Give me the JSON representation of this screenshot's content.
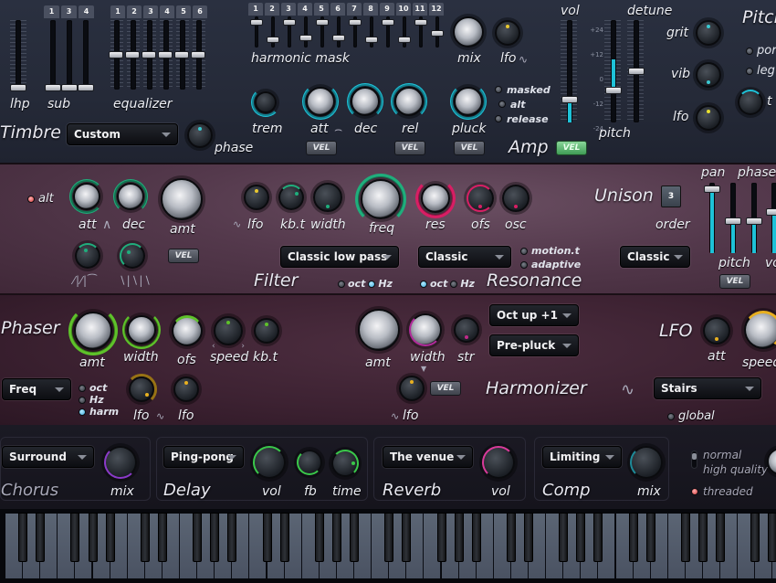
{
  "timbre": {
    "title": "Timbre",
    "preset": "Custom",
    "phase_label": "phase",
    "lhp_label": "lhp",
    "sub_label": "sub",
    "sub_tabs": [
      "1",
      "3",
      "4"
    ],
    "eq_label": "equalizer",
    "eq_tabs": [
      "1",
      "2",
      "3",
      "4",
      "5",
      "6"
    ],
    "harmonic_label": "harmonic mask",
    "harmonic_tabs": [
      "1",
      "2",
      "3",
      "4",
      "5",
      "6",
      "7",
      "8",
      "9",
      "10",
      "11",
      "12"
    ],
    "harmonic_levels": [
      0.9,
      0.2,
      0.9,
      0.3,
      0.9,
      0.3,
      0.9,
      0.2,
      0.9,
      0.2,
      0.9,
      0.45
    ],
    "mix_label": "mix",
    "lfo_label": "lfo"
  },
  "amp": {
    "title": "Amp",
    "trem_label": "trem",
    "att_label": "att",
    "dec_label": "dec",
    "rel_label": "rel",
    "pluck_label": "pluck",
    "vel_label": "VEL",
    "options": [
      "masked",
      "alt",
      "release"
    ],
    "vol_label": "vol",
    "vol_level": 0.2,
    "pitch_label": "pitch",
    "detune_label": "detune",
    "pitch_scale": [
      "+24",
      "+12",
      "0",
      "-12",
      "-24"
    ],
    "pitch_level": 0.3,
    "detune_level": 0.5
  },
  "pitch": {
    "title": "Pitch",
    "grit_label": "grit",
    "vib_label": "vib",
    "lfo_label": "lfo",
    "options": [
      "por",
      "leg"
    ],
    "time_label": "t"
  },
  "filter": {
    "title": "Filter",
    "alt_label": "alt",
    "att_label": "att",
    "dec_label": "dec",
    "amt_label": "amt",
    "vel_label": "VEL",
    "lfo_label": "lfo",
    "kbt_label": "kb.t",
    "width_label": "width",
    "freq_label": "freq",
    "type": "Classic low pass",
    "unit_oct": "oct",
    "unit_hz": "Hz",
    "unit_selected": "Hz"
  },
  "resonance": {
    "title": "Resonance",
    "res_label": "res",
    "ofs_label": "ofs",
    "osc_label": "osc",
    "type": "Classic",
    "options": [
      "motion.t",
      "adaptive"
    ],
    "unit_oct": "oct",
    "unit_hz": "Hz",
    "unit_selected": "oct"
  },
  "unison": {
    "title": "Unison",
    "order_label": "order",
    "order_value": "3",
    "type": "Classic",
    "pan_label": "pan",
    "phase_label": "phase",
    "pitch_label": "pitch",
    "vol_label": "vo",
    "vel_label": "VEL",
    "pan_level": 0.95,
    "pitch_level": 0.45,
    "phase_level": 0.45,
    "vol_level": 0.6
  },
  "phaser": {
    "title": "Phaser",
    "amt_label": "amt",
    "width_label": "width",
    "ofs_label": "ofs",
    "speed_label": "speed",
    "kbt_label": "kb.t",
    "mode": "Freq",
    "options": [
      "oct",
      "Hz",
      "harm"
    ],
    "selected": "harm",
    "lfo1_label": "lfo",
    "lfo2_label": "lfo"
  },
  "harmonizer": {
    "title": "Harmonizer",
    "amt_label": "amt",
    "width_label": "width",
    "str_label": "str",
    "interval": "Oct up +1",
    "mode": "Pre-pluck",
    "lfo_label": "lfo",
    "vel_label": "VEL"
  },
  "lfo": {
    "title": "LFO",
    "att_label": "att",
    "speed_label": "speed",
    "shape": "Stairs",
    "global_label": "global"
  },
  "effects": {
    "chorus": {
      "title": "Chorus",
      "preset": "Surround",
      "mix_label": "mix"
    },
    "delay": {
      "title": "Delay",
      "preset": "Ping-pong",
      "vol_label": "vol",
      "fb_label": "fb",
      "time_label": "time"
    },
    "reverb": {
      "title": "Reverb",
      "preset": "The venue",
      "vol_label": "vol"
    },
    "comp": {
      "title": "Comp",
      "preset": "Limiting",
      "mix_label": "mix"
    },
    "quality": {
      "normal_label": "normal",
      "high_label": "high quality",
      "threaded_label": "threaded"
    }
  },
  "colors": {
    "amp_accent": "#1ec2d8",
    "filter_accent": "#1fae7c",
    "resonance_accent": "#d81e64",
    "phaser_accent": "#5ec22a",
    "lfo_accent": "#e8b020",
    "vel_active": "#4fb864"
  }
}
